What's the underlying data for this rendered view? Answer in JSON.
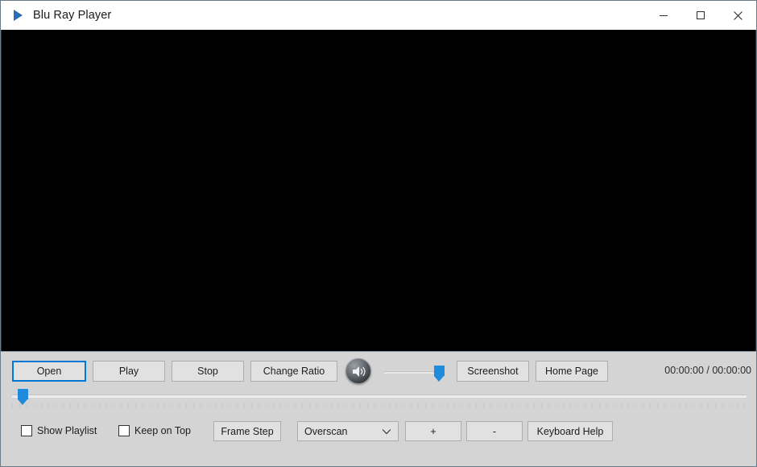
{
  "window": {
    "title": "Blu Ray Player",
    "app_icon": "play-triangle-icon",
    "minimize_label": "—",
    "maximize_label": "□",
    "close_label": "✕"
  },
  "video": {
    "background_color": "#000000"
  },
  "controls": {
    "open_label": "Open",
    "play_label": "Play",
    "stop_label": "Stop",
    "change_ratio_label": "Change Ratio",
    "volume_icon": "speaker-icon",
    "screenshot_label": "Screenshot",
    "home_page_label": "Home Page",
    "time_display": "00:00:00 / 00:00:00",
    "volume_value": 100,
    "seek_value": 0
  },
  "options": {
    "show_playlist_label": "Show Playlist",
    "show_playlist_checked": false,
    "keep_on_top_label": "Keep on Top",
    "keep_on_top_checked": false,
    "frame_step_label": "Frame Step",
    "overscan_selected": "Overscan",
    "plus_label": "+",
    "minus_label": "-",
    "keyboard_help_label": "Keyboard Help"
  },
  "colors": {
    "accent": "#0078d7",
    "slider_blue": "#1f8bdd",
    "panel_bg": "#d4d4d4",
    "button_bg": "#e1e1e1",
    "titlebar_bg": "#ffffff"
  }
}
